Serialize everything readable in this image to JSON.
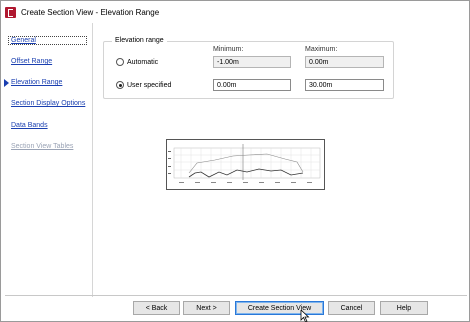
{
  "window": {
    "title": "Create Section View - Elevation Range"
  },
  "nav": {
    "items": [
      {
        "label": "General",
        "state": "normal"
      },
      {
        "label": "Offset Range",
        "state": "normal"
      },
      {
        "label": "Elevation Range",
        "state": "current"
      },
      {
        "label": "Section Display Options",
        "state": "normal"
      },
      {
        "label": "Data Bands",
        "state": "normal"
      },
      {
        "label": "Section View Tables",
        "state": "disabled"
      }
    ]
  },
  "elevation": {
    "group_title": "Elevation range",
    "minimum_label": "Minimum:",
    "maximum_label": "Maximum:",
    "automatic_label": "Automatic",
    "automatic_selected": false,
    "automatic_min": "-1.00m",
    "automatic_max": "0.00m",
    "user_label": "User specified",
    "user_selected": true,
    "user_min": "0.00m",
    "user_max": "30.00m"
  },
  "buttons": {
    "back": "< Back",
    "next": "Next >",
    "create": "Create Section View",
    "cancel": "Cancel",
    "help": "Help"
  },
  "colors": {
    "link": "#1a3fb0",
    "disabled_link": "#9aa3b5",
    "app_icon": "#b01830",
    "primary_button_border": "#2a78d8"
  }
}
